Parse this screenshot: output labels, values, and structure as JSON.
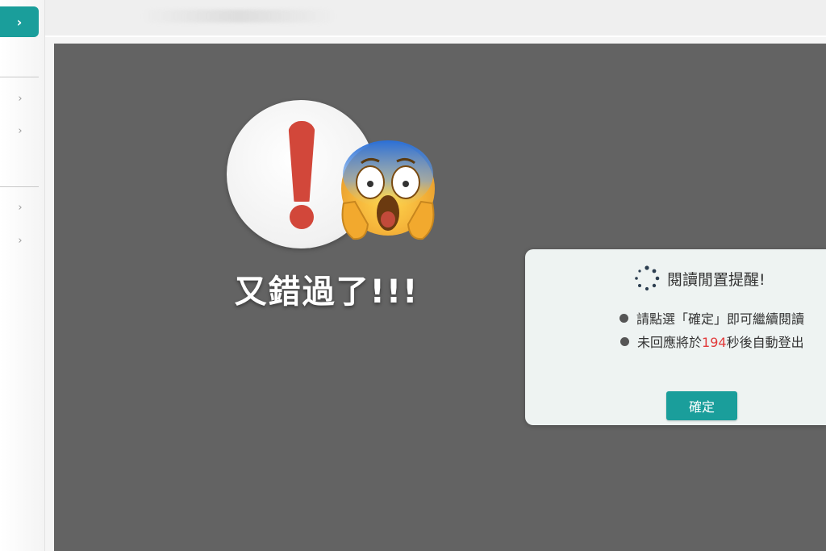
{
  "error": {
    "title": "又錯過了!!!",
    "warning_icon": "exclamation-circle-icon",
    "emoji_icon": "face-screaming-in-fear-icon"
  },
  "dialog": {
    "title": "閱讀閒置提醒!",
    "spinner_icon": "loading-spinner-icon",
    "line1": "請點選「確定」即可繼續閱讀",
    "line2_prefix": "未回應將於",
    "countdown": "194",
    "line2_suffix": "秒後自動登出",
    "confirm_label": "確定"
  },
  "sidebar": {
    "toggle_icon": "chevron-right-icon",
    "items": [
      {
        "icon": "chevron-right-icon"
      },
      {
        "icon": "chevron-right-icon"
      },
      {
        "icon": "chevron-right-icon"
      },
      {
        "icon": "chevron-right-icon"
      }
    ]
  },
  "colors": {
    "accent": "#1a9e9b",
    "overlay": "#636363",
    "alert_red": "#d2473a",
    "countdown_red": "#e23a3a"
  }
}
